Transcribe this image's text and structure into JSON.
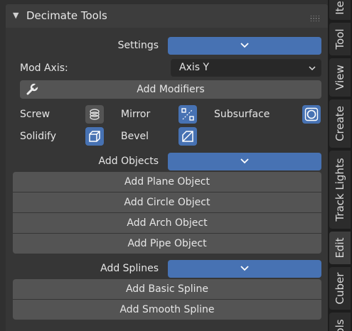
{
  "panel": {
    "title": "Decimate Tools",
    "collapse_icon": "triangle-down-icon",
    "grip_icon": "drag-grip-icon"
  },
  "settings": {
    "label": "Settings"
  },
  "mod_axis": {
    "label": "Mod Axis:",
    "value": "Axis Y"
  },
  "add_modifiers": {
    "label": "Add Modifiers",
    "icon": "wrench-icon"
  },
  "modifiers": [
    {
      "label": "Screw",
      "icon": "screw-icon",
      "active": false
    },
    {
      "label": "Mirror",
      "icon": "mirror-icon",
      "active": true
    },
    {
      "label": "Subsurface",
      "icon": "subsurface-icon",
      "active": true
    },
    {
      "label": "Solidify",
      "icon": "solidify-icon",
      "active": true
    },
    {
      "label": "Bevel",
      "icon": "bevel-icon",
      "active": true
    }
  ],
  "add_objects": {
    "label": "Add Objects",
    "buttons": [
      "Add Plane Object",
      "Add Circle Object",
      "Add Arch Object",
      "Add Pipe Object"
    ]
  },
  "add_splines": {
    "label": "Add Splines",
    "buttons": [
      "Add Basic Spline",
      "Add Smooth Spline"
    ]
  },
  "tabs": [
    "Ite",
    "Tool",
    "View",
    "Create",
    "Track Lights",
    "Edit",
    "Cuber",
    "ols"
  ],
  "active_tab": "Edit",
  "colors": {
    "accent": "#4772b3",
    "button": "#545454",
    "panel": "#363636",
    "header": "#3d3d3d"
  }
}
